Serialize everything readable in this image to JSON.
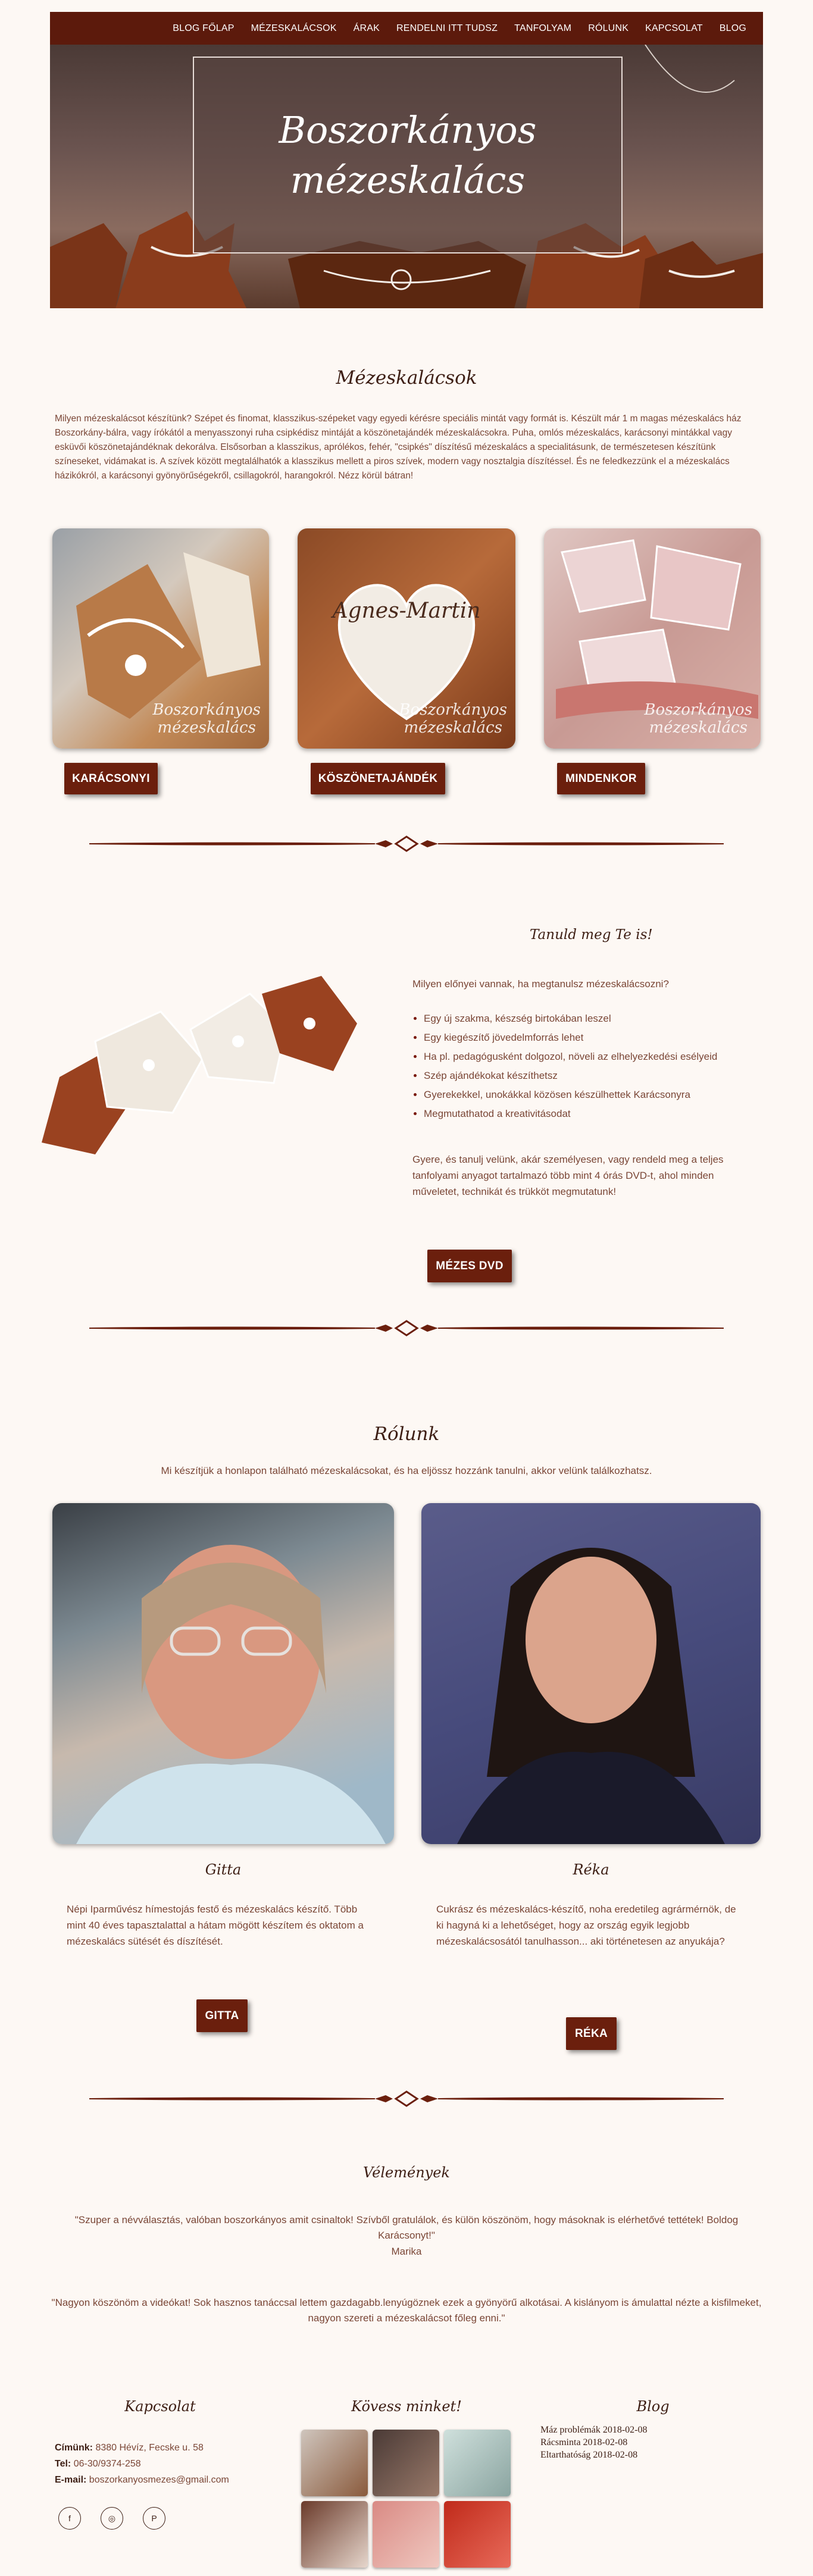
{
  "nav": {
    "items": [
      "BLOG FŐLAP",
      "MÉZESKALÁCSOK",
      "ÁRAK",
      "RENDELNI ITT TUDSZ",
      "TANFOLYAM",
      "RÓLUNK",
      "KAPCSOLAT",
      "BLOG"
    ]
  },
  "hero": {
    "title_line1": "Boszorkányos",
    "title_line2": "mézeskalács"
  },
  "mezeskalacsok": {
    "heading": "Mézeskalácsok",
    "intro": "Milyen mézeskalácsot készítünk? Szépet és finomat, klasszikus-szépeket vagy egyedi kérésre speciális mintát vagy formát is. Készült már 1 m magas mézeskalács ház Boszorkány-bálra, vagy írókától a menyasszonyi ruha csipkédisz mintáját a köszönetajándék mézeskalácsokra. Puha, omlós mézeskalács, karácsonyi mintákkal vagy esküvői köszönetajándéknak dekorálva. Elsősorban a klasszikus, aprólékos, fehér, \"csipkés\" díszítésű mézeskalács a specialitásunk, de természetesen készítünk színeseket, vidámakat is. A szívek között megtalálhatók a klasszikus mellett a piros szívek, modern vagy nosztalgia díszítéssel. És ne feledkezzünk el a mézeskalács házikókról, a karácsonyi gyönyörűségekről, csillagokról, harangokról. Nézz körül bátran!",
    "watermark_line1": "Boszorkányos",
    "watermark_line2": "mézeskalács",
    "heart_text": "Agnes-Martin",
    "buttons": [
      "KARÁCSONYI",
      "KÖSZÖNETAJÁNDÉK",
      "MINDENKOR"
    ]
  },
  "tanfolyam": {
    "heading": "Tanuld meg Te is!",
    "question": "Milyen előnyei vannak, ha megtanulsz mézeskalácsozni?",
    "advantages": [
      "Egy új szakma, készség birtokában leszel",
      "Egy kiegészítő jövedelmforrás lehet",
      "Ha pl. pedagógusként dolgozol, növeli az elhelyezkedési esélyeid",
      "Szép ajándékokat készíthetsz",
      "Gyerekekkel, unokákkal közösen készülhettek Karácsonyra",
      "Megmutathatod a kreativitásodat"
    ],
    "outro": "Gyere, és tanulj velünk, akár személyesen, vagy rendeld meg a teljes tanfolyami anyagot tartalmazó több mint 4 órás DVD-t, ahol minden műveletet, technikát és trükköt megmutatunk!",
    "button": "MÉZES DVD"
  },
  "rolunk": {
    "heading": "Rólunk",
    "intro": "Mi készítjük a honlapon található mézeskalácsokat, és ha eljössz hozzánk tanulni, akkor velünk találkozhatsz.",
    "people": [
      {
        "name": "Gitta",
        "text": "Népi Iparművész hímestojás festő és mézeskalács készítő. Több mint 40 éves tapasztalattal a hátam mögött készítem és oktatom a mézeskalács sütését és díszítését.",
        "button": "GITTA"
      },
      {
        "name": "Réka",
        "text": "Cukrász és mézeskalács-készítő, noha eredetileg agrármérnök, de ki hagyná ki a lehetőséget, hogy az ország egyik legjobb mézeskalácsosától tanulhasson... aki történetesen az anyukája?",
        "button": "RÉKA"
      }
    ]
  },
  "velemenyek": {
    "heading": "Vélemények",
    "quote1": "\"Szuper a névválasztás, valóban boszorkányos amit csinaltok! Szívből gratulálok, és külön köszönöm, hogy másoknak is elérhetővé tettétek! Boldog Karácsonyt!\"",
    "author1": "Marika",
    "quote2": "\"Nagyon köszönöm a videókat! Sok hasznos tanáccsal lettem gazdagabb.lenyúgöznek ezek a gyönyörű alkotásai. A kislányom is ámulattal nézte a kisfilmeket, nagyon szereti a mézeskalácsot főleg enni.\""
  },
  "footer": {
    "contact_heading": "Kapcsolat",
    "address_label": "Címünk:",
    "address": "8380 Hévíz, Fecske u. 58",
    "phone_label": "Tel:",
    "phone": "06-30/9374-258",
    "email_label": "E-mail:",
    "email": "boszorkanyosmezes@gmail.com",
    "social_icons": [
      "facebook-icon",
      "instagram-icon",
      "pinterest-icon"
    ],
    "follow_heading": "Kövess minket!",
    "blog_heading": "Blog",
    "blog_posts": [
      "Máz problémák 2018-02-08",
      "Rácsminta 2018-02-08",
      "Eltarthatóság 2018-02-08"
    ]
  },
  "colors": {
    "brand": "#5c1a0c",
    "button": "#6b1f0d",
    "background": "#fdf8f4"
  }
}
